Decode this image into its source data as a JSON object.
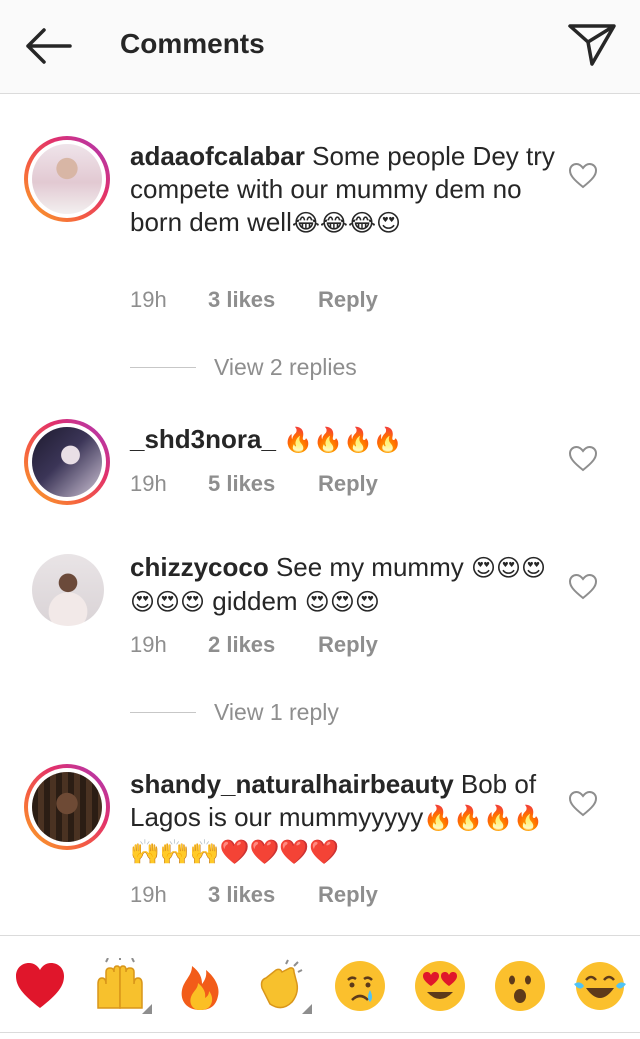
{
  "header": {
    "title": "Comments",
    "back_icon": "arrow-left-icon",
    "send_icon": "paper-plane-icon"
  },
  "comments": [
    {
      "username": "adaaofcalabar",
      "text": " Some people Dey try compete with our mummy dem no born dem well",
      "emojis": "😂😂😂😍",
      "time": "19h",
      "likes": "3 likes",
      "reply": "Reply",
      "view_replies": "View 2 replies"
    },
    {
      "username": "_shd3nora_",
      "text": " ",
      "emojis": "🔥🔥🔥🔥",
      "time": "19h",
      "likes": "5 likes",
      "reply": "Reply"
    },
    {
      "username": "chizzycoco",
      "text_a": " See my mummy ",
      "emojis_a": "😍😍😍😍😍😍",
      "text_b": " giddem ",
      "emojis_b": "😍😍😍",
      "time": "19h",
      "likes": "2 likes",
      "reply": "Reply",
      "view_replies": "View 1 reply"
    },
    {
      "username": "shandy_naturalhairbeauty",
      "text": " Bob of Lagos is our mummyyyyy",
      "emojis": "🔥🔥🔥🔥🙌🙌🙌❤️❤️❤️❤️",
      "time": "19h",
      "likes": "3 likes",
      "reply": "Reply"
    }
  ],
  "emoji_bar": [
    "❤️",
    "🙌",
    "🔥",
    "👏",
    "😢",
    "😍",
    "😮",
    "😂"
  ],
  "colors": {
    "text": "#262626",
    "secondary": "#8e8e8e",
    "divider": "#dbdbdb",
    "story_ring": [
      "#f9a825",
      "#e1306c",
      "#a23ac4"
    ]
  }
}
